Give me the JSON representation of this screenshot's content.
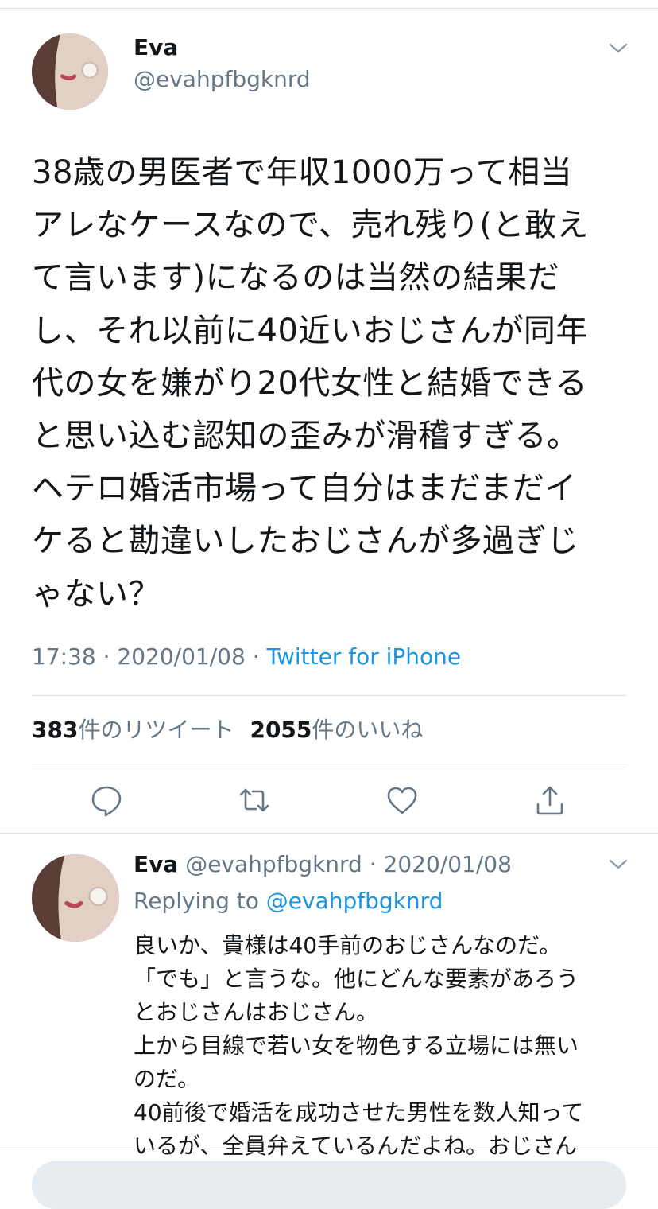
{
  "main_tweet": {
    "author_name": "Eva",
    "author_handle": "@evahpfbgknrd",
    "text_lines": [
      "38歳の男医者で年収1000万って相当",
      "アレなケースなので、売れ残り(と敢え",
      "て言います)になるのは当然の結果だ",
      "し、それ以前に40近いおじさんが同年",
      "代の女を嫌がり20代女性と結婚できる",
      "と思い込む認知の歪みが滑稽すぎる。",
      "ヘテロ婚活市場って自分はまだまだイ",
      "ケると勘違いしたおじさんが多過ぎじ",
      "ゃない？"
    ],
    "time": "17:38",
    "date": "2020/01/08",
    "separator": " · ",
    "source": "Twitter for iPhone",
    "retweet_count": "383",
    "retweet_label": "件のリツイート",
    "like_count": "2055",
    "like_label": "件のいいね"
  },
  "actions": {
    "icons": [
      "reply-icon",
      "retweet-icon",
      "like-icon",
      "share-icon"
    ]
  },
  "reply_tweet": {
    "author_name": "Eva",
    "author_handle": "@evahpfbgknrd",
    "date": "2020/01/08",
    "replying_prefix": "Replying to",
    "replying_handle": "@evahpfbgknrd",
    "text_lines": [
      "良いか、貴様は40手前のおじさんなのだ。",
      "「でも」と言うな。他にどんな要素があろう",
      "とおじさんはおじさん。",
      "上から目線で若い女を物色する立場には無い",
      "のだ。",
      "40前後で婚活を成功させた男性を数人知って",
      "いるが、全員弁えているんだよね。おじさん"
    ]
  },
  "colors": {
    "text": "#14171a",
    "secondary": "#657786",
    "link": "#1b95e0",
    "divider": "#dfe3e6"
  }
}
